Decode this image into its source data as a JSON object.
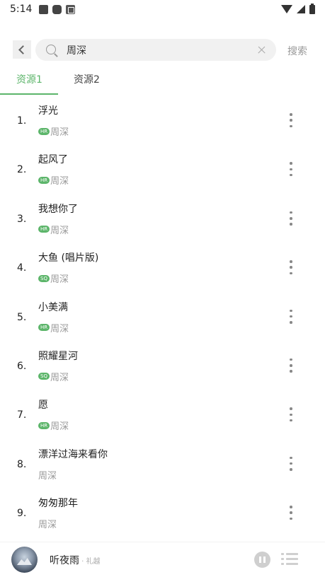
{
  "status_bar": {
    "time": "5:14"
  },
  "search": {
    "query": "周深",
    "button_label": "搜索"
  },
  "tabs": [
    {
      "label": "资源1",
      "active": true
    },
    {
      "label": "资源2",
      "active": false
    }
  ],
  "songs": [
    {
      "index": "1.",
      "title": "浮光",
      "quality": "HR",
      "artist": "周深"
    },
    {
      "index": "2.",
      "title": "起风了",
      "quality": "HR",
      "artist": "周深"
    },
    {
      "index": "3.",
      "title": "我想你了",
      "quality": "HR",
      "artist": "周深"
    },
    {
      "index": "4.",
      "title": "大鱼 (唱片版)",
      "quality": "SQ",
      "artist": "周深"
    },
    {
      "index": "5.",
      "title": "小美满",
      "quality": "HR",
      "artist": "周深"
    },
    {
      "index": "6.",
      "title": "照耀星河",
      "quality": "SQ",
      "artist": "周深"
    },
    {
      "index": "7.",
      "title": "愿",
      "quality": "HR",
      "artist": "周深"
    },
    {
      "index": "8.",
      "title": "漂洋过海来看你",
      "quality": "",
      "artist": "周深"
    },
    {
      "index": "9.",
      "title": "匆匆那年",
      "quality": "",
      "artist": "周深"
    }
  ],
  "player": {
    "title": "听夜雨",
    "artist": " · 礼越"
  },
  "colors": {
    "accent": "#5cb56a",
    "muted": "#999999"
  },
  "icons": [
    "back-icon",
    "search-icon",
    "clear-icon",
    "more-icon",
    "pause-icon",
    "playlist-icon"
  ]
}
